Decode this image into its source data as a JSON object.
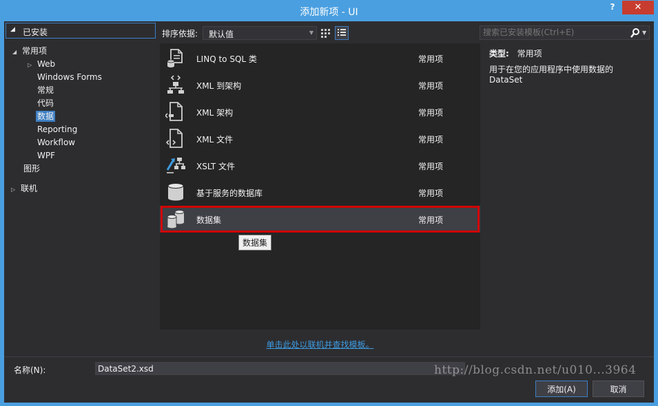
{
  "window": {
    "title": "添加新项 - UI",
    "help_label": "?",
    "close_label": "✕"
  },
  "sidebar": {
    "header": "已安装",
    "items": [
      {
        "label": "常用项",
        "toggle": "◢"
      },
      {
        "label": "Web",
        "toggle": "▷"
      },
      {
        "label": "Windows Forms",
        "toggle": ""
      },
      {
        "label": "常规",
        "toggle": ""
      },
      {
        "label": "代码",
        "toggle": ""
      },
      {
        "label": "数据",
        "toggle": ""
      },
      {
        "label": "Reporting",
        "toggle": ""
      },
      {
        "label": "Workflow",
        "toggle": ""
      },
      {
        "label": "WPF",
        "toggle": ""
      },
      {
        "label": "图形",
        "toggle": ""
      },
      {
        "label": "联机",
        "toggle": "▷"
      }
    ]
  },
  "toolbar": {
    "sort_label": "排序依据:",
    "sort_value": "默认值",
    "search_placeholder": "搜索已安装模板(Ctrl+E)"
  },
  "templates": [
    {
      "name": "LINQ to SQL 类",
      "category": "常用项",
      "icon": "linq-to-sql-icon"
    },
    {
      "name": "XML 到架构",
      "category": "常用项",
      "icon": "xml-to-schema-icon"
    },
    {
      "name": "XML 架构",
      "category": "常用项",
      "icon": "xml-schema-file-icon"
    },
    {
      "name": "XML 文件",
      "category": "常用项",
      "icon": "xml-file-icon"
    },
    {
      "name": "XSLT 文件",
      "category": "常用项",
      "icon": "xslt-file-icon"
    },
    {
      "name": "基于服务的数据库",
      "category": "常用项",
      "icon": "database-icon"
    },
    {
      "name": "数据集",
      "category": "常用项",
      "icon": "dataset-icon"
    }
  ],
  "tooltip": "数据集",
  "details": {
    "type_label": "类型:",
    "type_value": "常用项",
    "description": "用于在您的应用程序中使用数据的 DataSet"
  },
  "online_link": "单击此处以联机并查找模板。",
  "bottom": {
    "name_label": "名称(N):",
    "name_value": "DataSet2.xsd",
    "add_button": "添加(A)",
    "cancel_button": "取消"
  },
  "watermark": "http://blog.csdn.net/u010...3964",
  "colors": {
    "accent": "#3e7fc3",
    "highlight_border": "#d00000",
    "link": "#3e9be0",
    "background": "#2d2d30"
  }
}
